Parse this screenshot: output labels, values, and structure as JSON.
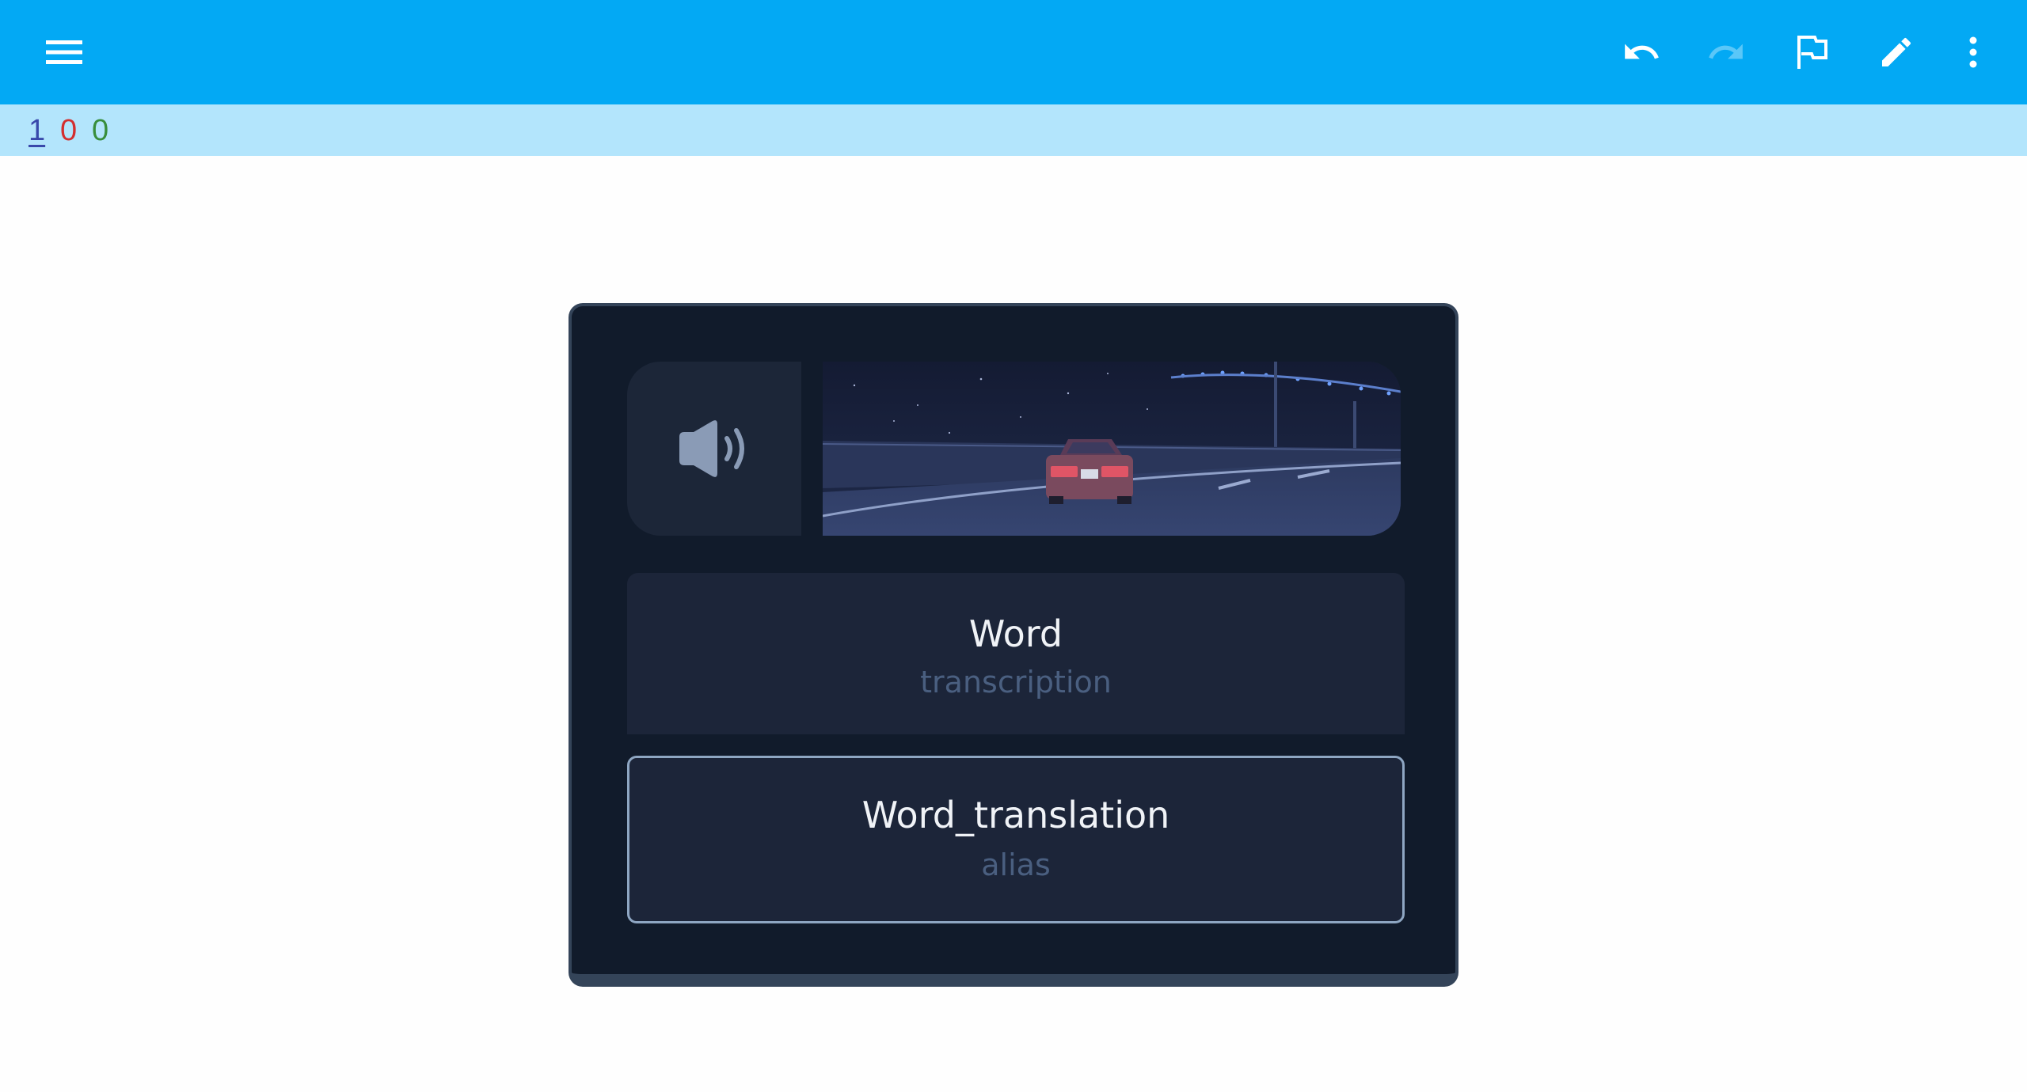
{
  "toolbar": {
    "color": "#03a9f4",
    "icons": [
      "menu-icon",
      "undo-icon",
      "redo-icon",
      "flag-icon",
      "edit-icon",
      "more-vert-icon"
    ]
  },
  "counts": {
    "new": "1",
    "learning": "0",
    "review": "0",
    "colors": {
      "new": "#3949ab",
      "learning": "#d32f2f",
      "review": "#388e3c"
    }
  },
  "card": {
    "front_word": "Word",
    "front_sub": "transcription",
    "back_word": "Word_translation",
    "back_sub": "alias",
    "audio_icon": "speaker-icon",
    "image": "night-highway-car-image"
  }
}
